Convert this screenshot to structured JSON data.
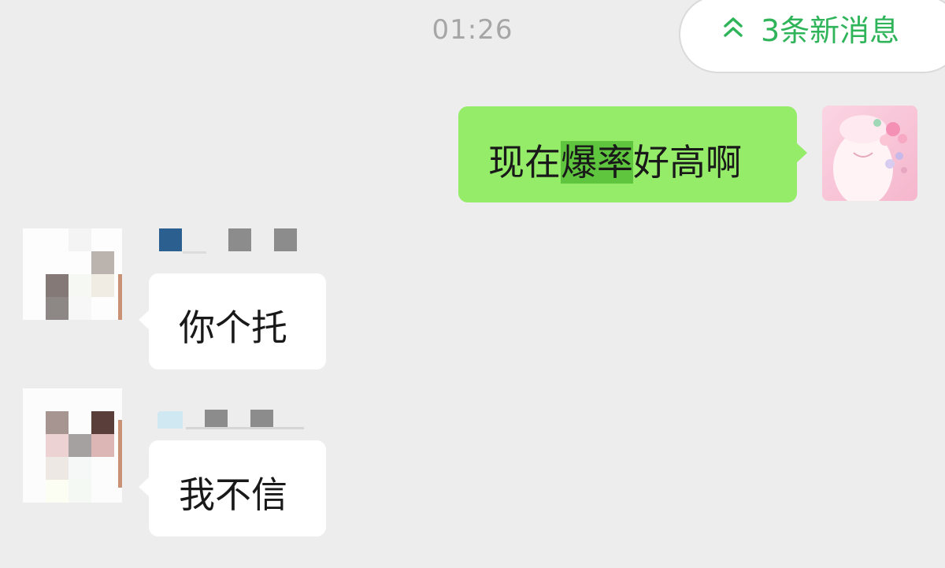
{
  "chat": {
    "timestamp": "01:26",
    "new_messages_label": "3条新消息",
    "messages": [
      {
        "direction": "outgoing",
        "text_before": "现在",
        "text_highlight": "爆率",
        "text_after": "好高啊"
      },
      {
        "direction": "incoming",
        "text": "你个托"
      },
      {
        "direction": "incoming",
        "text": "我不信"
      }
    ]
  },
  "colors": {
    "background": "#ededed",
    "outgoing_bubble": "#95ec69",
    "incoming_bubble": "#ffffff",
    "highlight": "#5fc43e",
    "accent_green": "#2fb45a",
    "timestamp_gray": "#a6a6a6"
  },
  "icons": {
    "new_messages_arrow": "double-chevron-up-icon"
  }
}
